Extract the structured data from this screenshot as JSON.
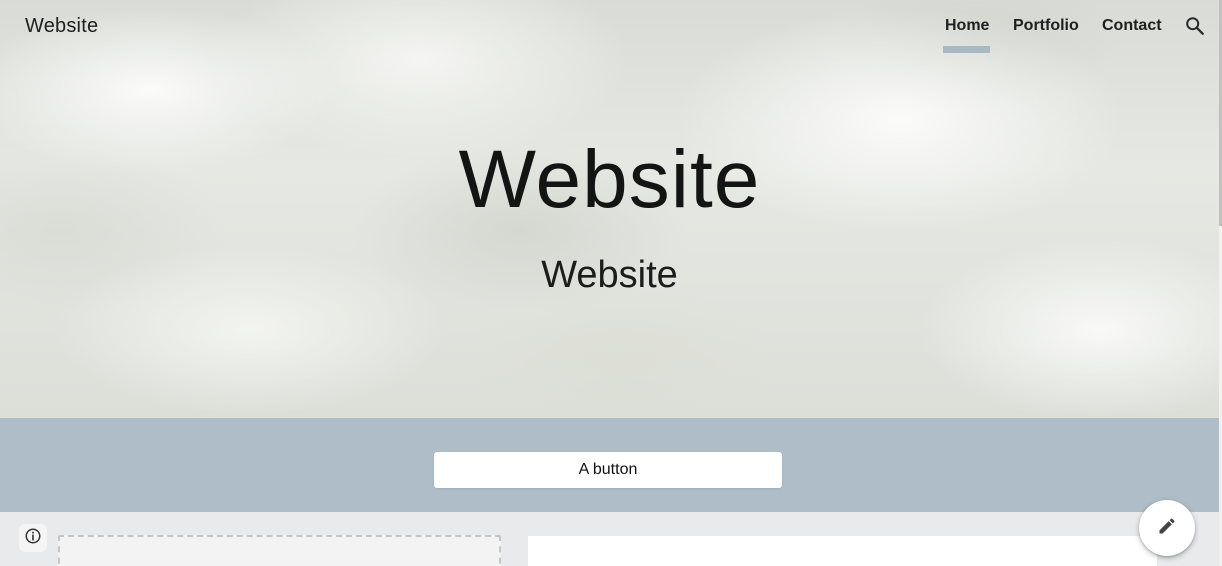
{
  "header": {
    "brand": "Website",
    "nav": [
      {
        "label": "Home",
        "active": true
      },
      {
        "label": "Portfolio",
        "active": false
      },
      {
        "label": "Contact",
        "active": false
      }
    ],
    "search_icon": "search-icon"
  },
  "hero": {
    "title": "Website",
    "subtitle": "Website"
  },
  "cta": {
    "label": "A button"
  },
  "floating": {
    "info_icon": "info-icon",
    "edit_icon": "pencil-icon"
  },
  "colors": {
    "band": "#aebdc7",
    "nav_underline": "#a9b9c4",
    "page_bg": "#e8eaec"
  }
}
